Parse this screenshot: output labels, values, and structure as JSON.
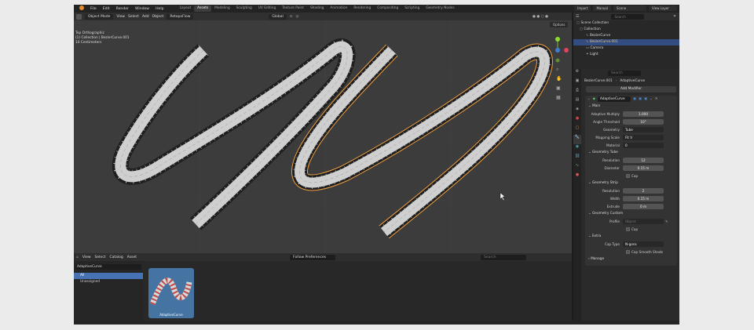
{
  "menu": [
    "File",
    "Edit",
    "Render",
    "Window",
    "Help"
  ],
  "workspaces": [
    "Layout",
    "Assets",
    "Modeling",
    "Sculpting",
    "UV Editing",
    "Texture Paint",
    "Shading",
    "Animation",
    "Rendering",
    "Compositing",
    "Scripting",
    "Geometry Nodes"
  ],
  "active_workspace": "Assets",
  "topright": {
    "import": "Import",
    "manual": "Manual",
    "scene": "Scene",
    "view_layer": "View Layer"
  },
  "viewport": {
    "mode": "Object Mode",
    "menus": [
      "View",
      "Select",
      "Add",
      "Object"
    ],
    "addon": "RetopoFlow",
    "transform": "Global",
    "overlay_lines": [
      "Top Orthographic",
      "(1) Collection | BezierCurve.001",
      "10 Centimeters"
    ],
    "options": "Options"
  },
  "asset_browser": {
    "menus": [
      "View",
      "Select",
      "Catalog",
      "Asset"
    ],
    "import_method": "Follow Preferences",
    "search_placeholder": "Search",
    "library": "AdaptiveCurve",
    "catalogs": [
      "All",
      "Unassigned"
    ],
    "asset_name": "AdaptiveCurve"
  },
  "outliner": {
    "search_placeholder": "Search",
    "items": [
      {
        "name": "Scene Collection"
      },
      {
        "name": "Collection"
      },
      {
        "name": "BezierCurve"
      },
      {
        "name": "BezierCurve.001"
      },
      {
        "name": "Camera"
      },
      {
        "name": "Light"
      }
    ]
  },
  "properties": {
    "search_placeholder": "Search",
    "breadcrumb": [
      "BezierCurve.001",
      "AdaptiveCurve"
    ],
    "add_modifier": "Add Modifier",
    "modifier_name": "AdaptiveCurve",
    "sections": {
      "main": "Main",
      "tube": "Geometry Tube",
      "strip": "Geometry Strip",
      "custom": "Geometry Custom",
      "extra": "Extra",
      "manage": "Manage"
    },
    "main": [
      {
        "label": "Adaptive Multiply",
        "value": "1.000"
      },
      {
        "label": "Angle Threshold",
        "value": "10°"
      },
      {
        "label": "Geometry",
        "value": "Tube"
      },
      {
        "label": "Mapping Scale",
        "value": "Fit V"
      },
      {
        "label": "Material",
        "value": "0"
      }
    ],
    "tube": [
      {
        "label": "Resolution",
        "value": "12"
      },
      {
        "label": "Diameter",
        "value": "0.15 m"
      }
    ],
    "tube_cap": "Cap",
    "strip": [
      {
        "label": "Resolution",
        "value": "2"
      },
      {
        "label": "Width",
        "value": "0.15 m"
      },
      {
        "label": "Extrude",
        "value": "0 m"
      }
    ],
    "custom_profile_label": "Profile",
    "custom_profile_placeholder": "Object",
    "custom_cap": "Cap",
    "extra_cap_type_label": "Cap Type",
    "extra_cap_type": "N-gons",
    "extra_smooth": "Cap Smooth Shade"
  },
  "colors": {
    "accent": "#4772b3",
    "selection_outline": "#f0a040",
    "logo": "#e58d2b"
  }
}
